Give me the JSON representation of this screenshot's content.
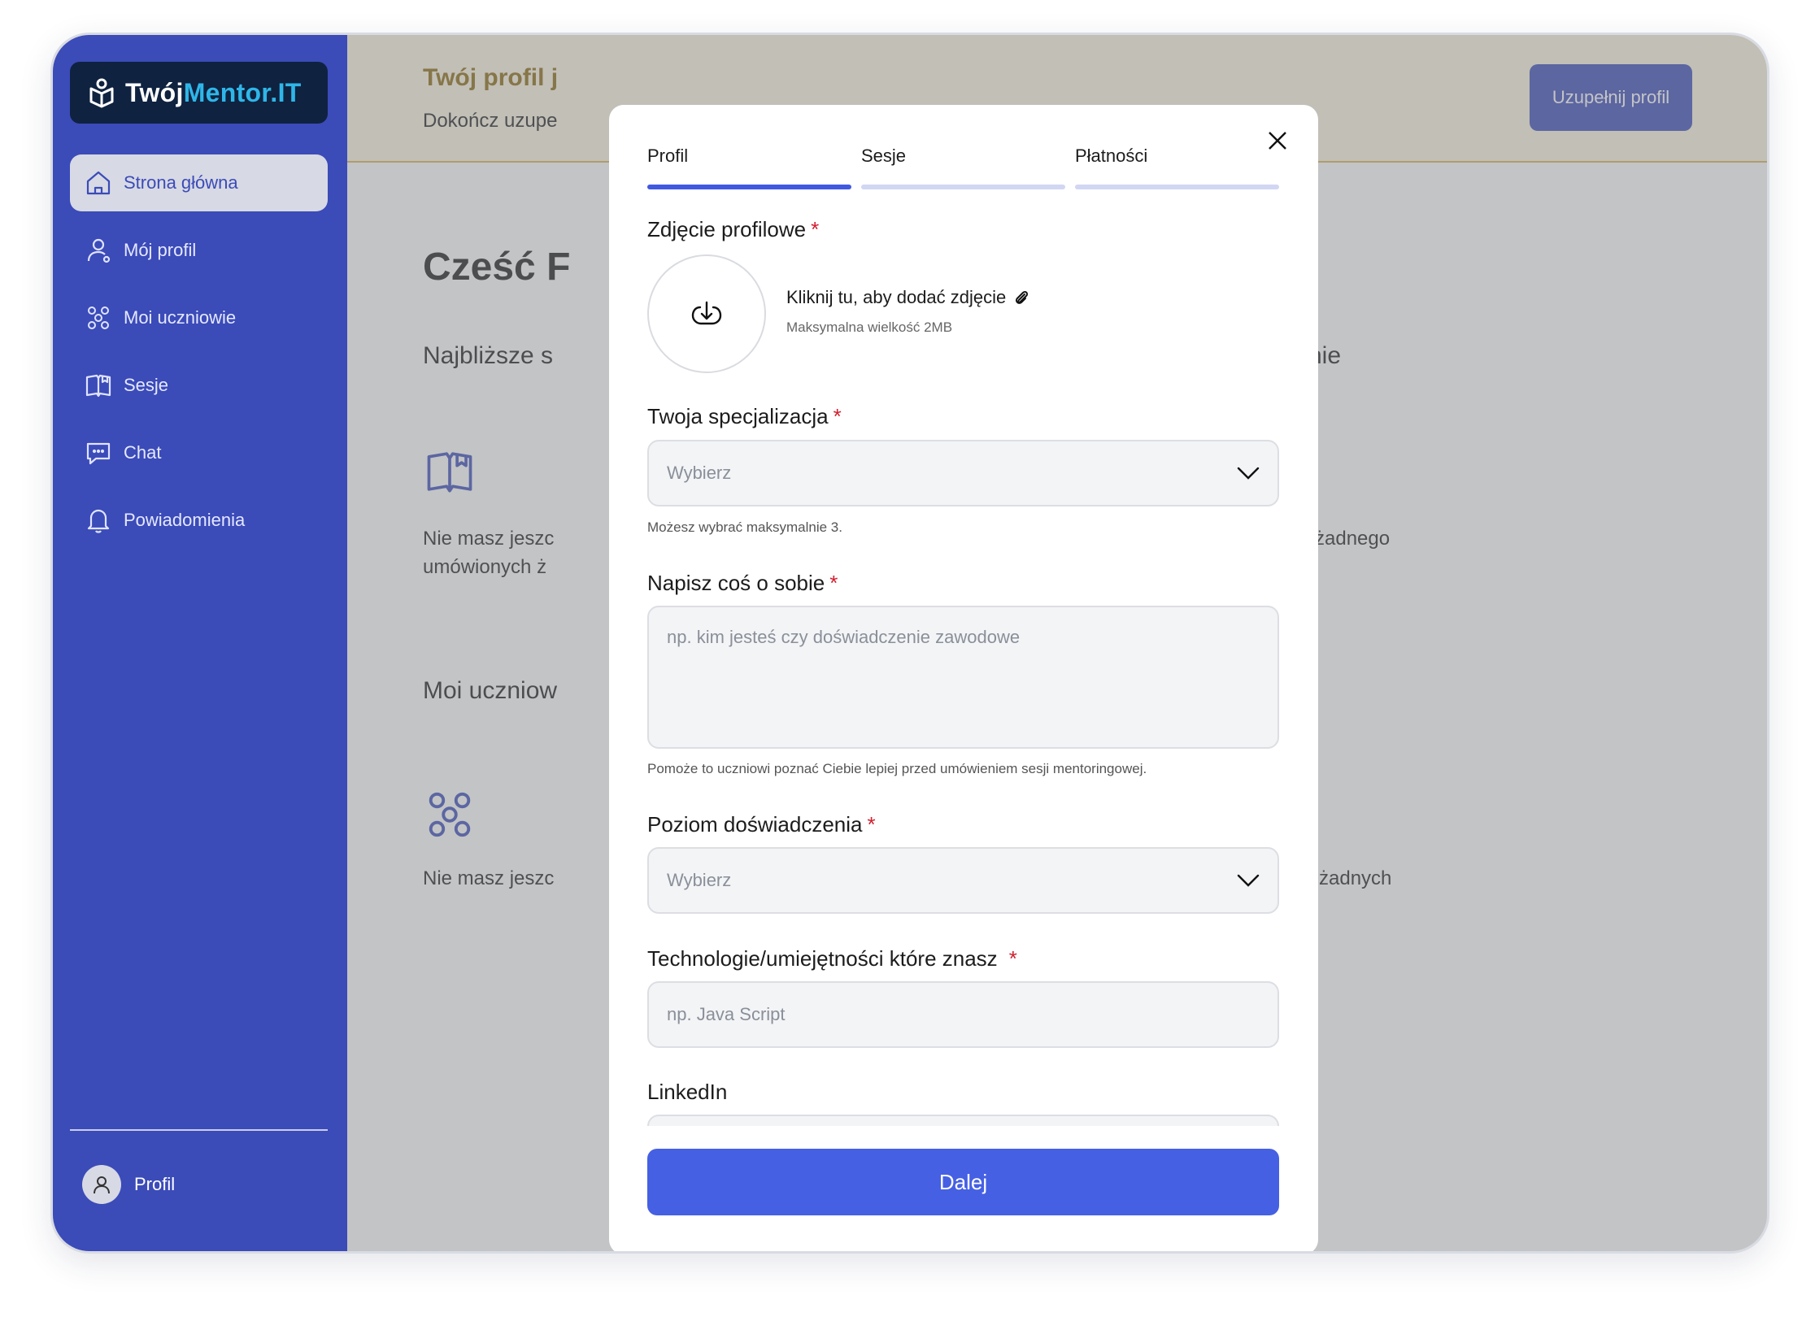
{
  "sidebar": {
    "logo": {
      "part1": "Twój",
      "part2": "Mentor.IT"
    },
    "items": [
      {
        "label": "Strona główna",
        "icon": "home-icon",
        "active": true
      },
      {
        "label": "Mój profil",
        "icon": "user-icon"
      },
      {
        "label": "Moi uczniowie",
        "icon": "students-icon"
      },
      {
        "label": "Sesje",
        "icon": "book-icon"
      },
      {
        "label": "Chat",
        "icon": "chat-icon"
      },
      {
        "label": "Powiadomienia",
        "icon": "bell-icon"
      }
    ],
    "profile_label": "Profil"
  },
  "banner": {
    "title": "Twój profil j",
    "subtitle": "Dokończ uzupe",
    "button": "Uzupełnij profil"
  },
  "main": {
    "greeting": "Cześć F",
    "section1_title": "Najbliższe s",
    "section1_right": "nie",
    "section1_empty_left": "Nie masz jeszc\numówionych ż",
    "section1_empty_right": "żadnego",
    "section2_title": "Moi uczniow",
    "section2_empty_left": "Nie masz jeszc",
    "section2_empty_right": "żadnych"
  },
  "modal": {
    "tabs": [
      {
        "label": "Profil",
        "active": true
      },
      {
        "label": "Sesje",
        "active": false
      },
      {
        "label": "Płatności",
        "active": false
      }
    ],
    "photo": {
      "label": "Zdjęcie profilowe",
      "action": "Kliknij tu, aby dodać zdjęcie",
      "hint": "Maksymalna wielkość 2MB"
    },
    "specialization": {
      "label": "Twoja specjalizacja",
      "placeholder": "Wybierz",
      "helper": "Możesz wybrać maksymalnie 3."
    },
    "about": {
      "label": "Napisz coś o sobie",
      "placeholder": "np. kim jesteś czy doświadczenie zawodowe",
      "helper": "Pomoże to uczniowi poznać Ciebie lepiej przed umówieniem sesji mentoringowej."
    },
    "experience": {
      "label": "Poziom doświadczenia",
      "placeholder": "Wybierz"
    },
    "technologies": {
      "label": "Technologie/umiejętności które znasz",
      "placeholder": "np. Java Script"
    },
    "linkedin": {
      "label": "LinkedIn"
    },
    "required_mark": "*",
    "next_button": "Dalej"
  },
  "colors": {
    "sidebar": "#3b4bb8",
    "accent": "#4560e3",
    "banner_bg": "#fbf5e0",
    "banner_title": "#8a6a10",
    "required": "#d01f2f"
  }
}
